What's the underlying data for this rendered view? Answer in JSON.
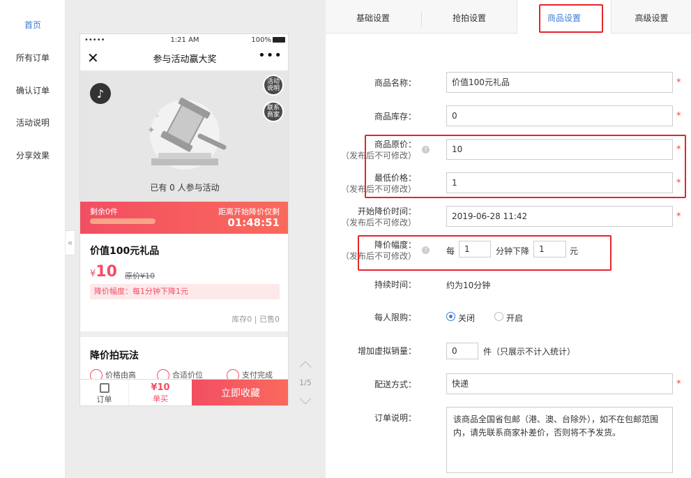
{
  "nav": {
    "items": [
      "首页",
      "所有订单",
      "确认订单",
      "活动说明",
      "分享效果"
    ],
    "active_index": 0
  },
  "preview": {
    "collapse_icon": "«",
    "status_signal": "•••••",
    "status_time": "1:21 AM",
    "status_battery": "100%",
    "close_icon": "✕",
    "page_title": "参与活动赢大奖",
    "more_icon": "•••",
    "music_icon": "♪",
    "activity_btn": "活动\n说明",
    "contact_btn": "联系\n商家",
    "participants_text": "已有 0 人参与活动",
    "remaining_label": "剩余0件",
    "countdown_label": "距离开始降价仅剩",
    "countdown_time": "01:48:51",
    "product_name": "价值100元礼品",
    "price_symbol": "¥",
    "price_value": "10",
    "original_price": "原价¥10",
    "discount_rule": "降价幅度：每1分钟下降1元",
    "stock_sold": "库存0 | 已售0",
    "play_title": "降价拍玩法",
    "play_steps": [
      "价格由高",
      "合适价位",
      "支付完成"
    ],
    "bottom_orders": "订单",
    "bottom_single_price": "¥10",
    "bottom_single_label": "单买",
    "bottom_collect": "立即收藏",
    "pager": "1/5"
  },
  "tabs": [
    "基础设置",
    "抢拍设置",
    "商品设置",
    "高级设置"
  ],
  "active_tab": 2,
  "form": {
    "product_name_label": "商品名称：",
    "product_name_value": "价值100元礼品",
    "stock_label": "商品库存：",
    "stock_value": "0",
    "orig_price_label": "商品原价：",
    "orig_price_sub": "（发布后不可修改）",
    "orig_price_value": "10",
    "min_price_label": "最低价格：",
    "min_price_sub": "（发布后不可修改）",
    "min_price_value": "1",
    "start_time_label": "开始降价时间：",
    "start_time_sub": "（发布后不可修改）",
    "start_time_value": "2019-06-28 11:42",
    "drop_label": "降价幅度：",
    "drop_sub": "（发布后不可修改）",
    "drop_every": "每",
    "drop_minutes_value": "1",
    "drop_minute_unit": "分钟下降",
    "drop_amount_value": "1",
    "drop_currency": "元",
    "duration_label": "持续时间：",
    "duration_value": "约为10分钟",
    "limit_label": "每人限购：",
    "limit_off": "关闭",
    "limit_on": "开启",
    "virtual_sales_label": "增加虚拟销量：",
    "virtual_sales_value": "0",
    "virtual_sales_unit": "件（只展示不计入统计）",
    "shipping_label": "配送方式：",
    "shipping_value": "快递",
    "order_note_label": "订单说明：",
    "order_note_value": "该商品全国省包邮（港、澳、台除外），如不在包邮范围内，请先联系商家补差价，否则将不予发货。",
    "required_mark": "*",
    "help_mark": "?"
  },
  "colors": {
    "accent": "#3a7bd5",
    "brand_red": "#f24e63",
    "highlight_red": "#e6242a"
  }
}
